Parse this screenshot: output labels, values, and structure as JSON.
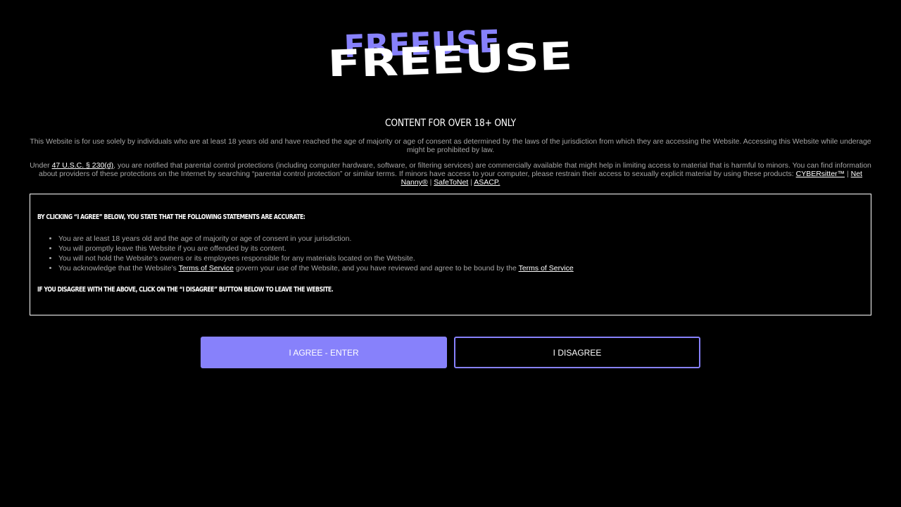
{
  "logo": {
    "text": "FREEUSE",
    "accent_color": "#8781fb"
  },
  "heading": "CONTENT FOR OVER 18+ ONLY",
  "intro": "This Website is for use solely by individuals who are at least 18 years old and have reached the age of majority or age of consent as determined by the laws of the jurisdiction from which they are accessing the Website. Accessing this Website while underage might be prohibited by law.",
  "notice": {
    "prefix": "Under ",
    "law_link": "47 U.S.C. § 230(d)",
    "body": ", you are notified that parental control protections (including computer hardware, software, or filtering services) are commercially available that might help in limiting access to material that is harmful to minors. You can find information about providers of these protections on the Internet by searching “parental control protection” or similar terms. If minors have access to your computer, please restrain their access to sexually explicit material by using these products: ",
    "products": [
      "CYBERsitter™",
      "Net Nanny®",
      "SafeToNet",
      "ASACP."
    ],
    "separator": " | "
  },
  "terms": {
    "heading": "BY CLICKING “I AGREE” BELOW, YOU STATE THAT THE FOLLOWING STATEMENTS ARE ACCURATE:",
    "items": [
      "You are at least 18 years old and the age of majority or age of consent in your jurisdiction.",
      "You will promptly leave this Website if you are offended by its content.",
      "You will not hold the Website’s owners or its employees responsible for any materials located on the Website."
    ],
    "last_item": {
      "part1": "You acknowledge that the Website’s ",
      "link1": "Terms of Service",
      "part2": " govern your use of the Website, and you have reviewed and agree to be bound by the ",
      "link2": "Terms of Service"
    },
    "footer": "IF YOU DISAGREE WITH THE ABOVE, CLICK ON THE “I DISAGREE” BUTTON BELOW TO LEAVE THE WEBSITE."
  },
  "buttons": {
    "agree": "I AGREE - ENTER",
    "disagree": "I DISAGREE"
  }
}
